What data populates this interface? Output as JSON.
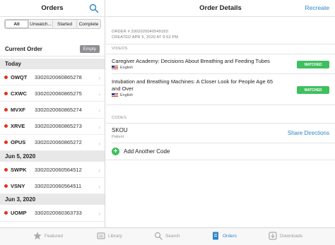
{
  "left": {
    "title": "Orders",
    "segments": [
      "All",
      "Unwatch...",
      "Started",
      "Complete"
    ],
    "current_order": {
      "label": "Current Order",
      "empty_label": "Empty"
    },
    "sections": [
      {
        "label": "Today",
        "orders": [
          {
            "code": "OWQT",
            "number": "3302020060865278"
          },
          {
            "code": "CXWC",
            "number": "3302020060865275"
          },
          {
            "code": "MVXF",
            "number": "3302020060865274"
          },
          {
            "code": "XRVE",
            "number": "3302020060865273"
          },
          {
            "code": "OPUS",
            "number": "3302020060865272"
          }
        ]
      },
      {
        "label": "Jun 5, 2020",
        "orders": [
          {
            "code": "SWPK",
            "number": "3302020060564512"
          },
          {
            "code": "VSNY",
            "number": "3302020060564511"
          }
        ]
      },
      {
        "label": "Jun 3, 2020",
        "orders": [
          {
            "code": "UOMP",
            "number": "3302020060363733"
          }
        ]
      }
    ]
  },
  "right": {
    "title": "Order Details",
    "recreate_label": "Recreate",
    "order_line": "ORDER # 3302020040549183:",
    "created_line": "CREATED APR 5, 2020 AT 9:53 PM",
    "videos_label": "VIDEOS",
    "videos": [
      {
        "title": "Caregiver Academy: Decisions About Breathing and Feeding Tubes",
        "language": "English",
        "status": "WATCHED"
      },
      {
        "title": "Intubation and Breathing Machines: A Closer Look for People Age 65 and Over",
        "language": "English",
        "status": "WATCHED"
      }
    ],
    "codes_label": "CODES",
    "code": {
      "name": "SKOU",
      "type": "Patient"
    },
    "share_label": "Share Directions",
    "add_code_label": "Add Another Code"
  },
  "tabbar": {
    "tabs": [
      {
        "label": "Featured",
        "icon": "star-icon",
        "active": false
      },
      {
        "label": "Library",
        "icon": "library-icon",
        "active": false
      },
      {
        "label": "Search",
        "icon": "search-icon",
        "active": false
      },
      {
        "label": "Orders",
        "icon": "orders-icon",
        "active": true
      },
      {
        "label": "Downloads",
        "icon": "downloads-icon",
        "active": false
      }
    ]
  },
  "colors": {
    "accent": "#2d86c7",
    "dot": "#e0341c",
    "watched": "#3fbf5f"
  }
}
